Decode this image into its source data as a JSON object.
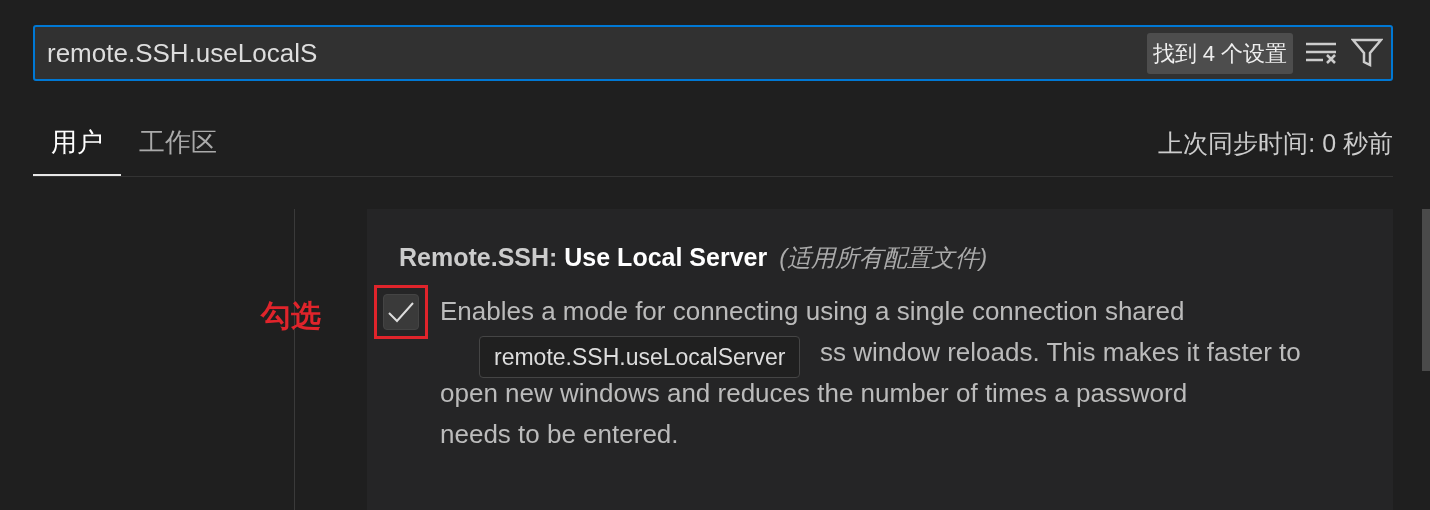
{
  "search": {
    "value": "remote.SSH.useLocalS",
    "result_count": "找到 4 个设置"
  },
  "tabs": [
    {
      "label": "用户",
      "selected": true
    },
    {
      "label": "工作区",
      "selected": false
    }
  ],
  "sync_status": "上次同步时间: 0 秒前",
  "setting": {
    "title": "Remote.SSH: **Use Local Server**",
    "scope": "(适用所有配置文件)",
    "checked": true,
    "description_lines": [
      "Enables a mode for connecting using a single connection shared",
      "ss window reloads. This makes it faster to",
      "open new windows and reduces the number of times a password",
      "needs to be entered."
    ]
  },
  "tooltip": "remote.SSH.useLocalServer",
  "annotation": {
    "label": "勾选"
  }
}
